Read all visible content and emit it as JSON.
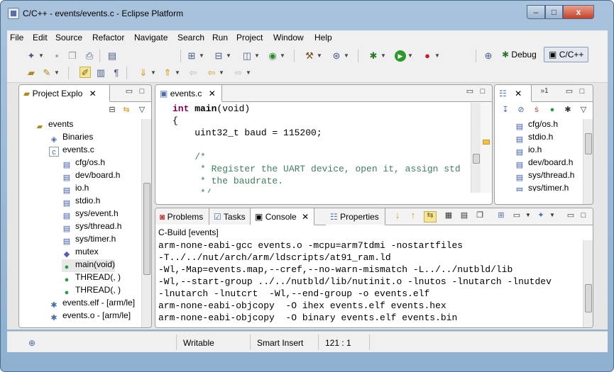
{
  "window": {
    "title": "C/C++ - events/events.c - Eclipse Platform",
    "controls": {
      "minimize": "–",
      "maximize": "□",
      "close": "x"
    }
  },
  "menu": [
    "File",
    "Edit",
    "Source",
    "Refactor",
    "Navigate",
    "Search",
    "Run",
    "Project",
    "Window",
    "Help"
  ],
  "perspectives": {
    "debug": "Debug",
    "cpp": "C/C++"
  },
  "project_explorer": {
    "tab_label": "Project Explo",
    "items": [
      {
        "label": "events",
        "icon": "project-folder-icon"
      },
      {
        "label": "Binaries",
        "icon": "binaries-icon"
      },
      {
        "label": "events.c",
        "icon": "c-file-icon"
      },
      {
        "label": "cfg/os.h",
        "icon": "include-icon"
      },
      {
        "label": "dev/board.h",
        "icon": "include-icon"
      },
      {
        "label": "io.h",
        "icon": "include-icon"
      },
      {
        "label": "stdio.h",
        "icon": "include-icon"
      },
      {
        "label": "sys/event.h",
        "icon": "include-icon"
      },
      {
        "label": "sys/thread.h",
        "icon": "include-icon"
      },
      {
        "label": "sys/timer.h",
        "icon": "include-icon"
      },
      {
        "label": "mutex",
        "icon": "variable-icon"
      },
      {
        "label": "main(void)",
        "icon": "function-icon"
      },
      {
        "label": "THREAD(, )",
        "icon": "function-icon"
      },
      {
        "label": "THREAD(, )",
        "icon": "function-icon"
      },
      {
        "label": "events.elf - [arm/le]",
        "icon": "binary-icon"
      },
      {
        "label": "events.o - [arm/le]",
        "icon": "binary-icon"
      }
    ]
  },
  "editor": {
    "tab_label": "events.c",
    "lines": [
      {
        "kind": "sig",
        "kw": "int",
        "name": " main",
        "rest": "(void)"
      },
      {
        "kind": "plain",
        "text": "{"
      },
      {
        "kind": "plain",
        "text": "    uint32_t baud = 115200;"
      },
      {
        "kind": "blank",
        "text": ""
      },
      {
        "kind": "comment",
        "text": "    /*"
      },
      {
        "kind": "comment",
        "text": "     * Register the UART device, open it, assign std"
      },
      {
        "kind": "comment",
        "text": "     * the baudrate."
      },
      {
        "kind": "comment",
        "text": "     */"
      }
    ]
  },
  "outline": {
    "overflow_label": "»1",
    "items": [
      {
        "label": "cfg/os.h",
        "icon": "include-icon"
      },
      {
        "label": "stdio.h",
        "icon": "include-icon"
      },
      {
        "label": "io.h",
        "icon": "include-icon"
      },
      {
        "label": "dev/board.h",
        "icon": "include-icon"
      },
      {
        "label": "sys/thread.h",
        "icon": "include-icon"
      },
      {
        "label": "sys/timer.h",
        "icon": "include-icon"
      }
    ]
  },
  "bottom_tabs": {
    "problems": "Problems",
    "tasks": "Tasks",
    "console": "Console",
    "properties": "Properties"
  },
  "console": {
    "header": "C-Build [events]",
    "lines": [
      "arm-none-eabi-gcc events.o -mcpu=arm7tdmi -nostartfiles",
      "-T../../nut/arch/arm/ldscripts/at91_ram.ld",
      "-Wl,-Map=events.map,--cref,--no-warn-mismatch -L../../nutbld/lib",
      "-Wl,--start-group ../../nutbld/lib/nutinit.o -lnutos -lnutarch -lnutdev",
      "-lnutarch -lnutcrt  -Wl,--end-group -o events.elf",
      "arm-none-eabi-objcopy  -O ihex events.elf events.hex",
      "arm-none-eabi-objcopy  -O binary events.elf events.bin"
    ]
  },
  "status": {
    "writable": "Writable",
    "insert_mode": "Smart Insert",
    "position": "121 : 1"
  }
}
